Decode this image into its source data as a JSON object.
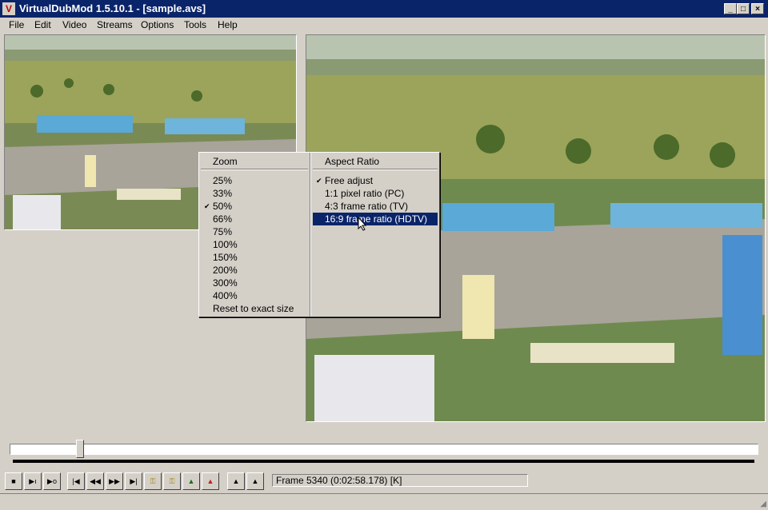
{
  "window": {
    "title": "VirtualDubMod 1.5.10.1 - [sample.avs]",
    "app_icon": "virtualdub-icon",
    "minimize": "_",
    "maximize": "□",
    "close": "×"
  },
  "menu": [
    "File",
    "Edit",
    "Video",
    "Streams",
    "Options",
    "Tools",
    "Help"
  ],
  "context_menu": {
    "zoom_header": "Zoom",
    "zoom_items": [
      "25%",
      "33%",
      "50%",
      "66%",
      "75%",
      "100%",
      "150%",
      "200%",
      "300%",
      "400%",
      "Reset to exact size"
    ],
    "zoom_checked": "50%",
    "aspect_header": "Aspect Ratio",
    "aspect_items": [
      "Free adjust",
      "1:1 pixel ratio (PC)",
      "4:3 frame ratio (TV)",
      "16:9 frame ratio (HDTV)"
    ],
    "aspect_checked": "Free adjust",
    "aspect_highlighted": "16:9 frame ratio (HDTV)"
  },
  "timeline": {
    "position_fraction": 0.09
  },
  "toolbar": {
    "buttons": [
      "stop-icon",
      "play-input-icon",
      "play-output-icon",
      "go-start-icon",
      "step-back-icon",
      "step-forward-icon",
      "go-end-icon",
      "prev-key-icon",
      "next-key-icon",
      "scene-back-icon",
      "scene-forward-icon",
      "mark-in-icon",
      "mark-out-icon"
    ],
    "status": "Frame 5340 (0:02:58.178) [K]"
  },
  "colors": {
    "title_bar": "#0a246a",
    "selection": "#0a246a",
    "face": "#d4d0c8"
  }
}
